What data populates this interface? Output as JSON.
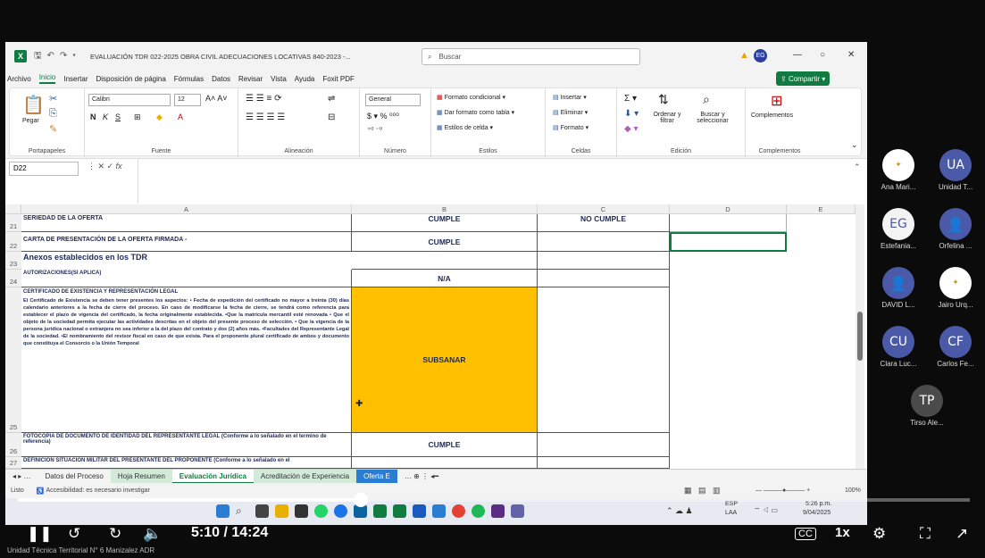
{
  "excel": {
    "title": "EVALUACIÓN TDR 022-2025 OBRA CIVIL ADECUACIONES LOCATIVAS 840-2023 -...",
    "search_placeholder": "Buscar",
    "user_initials": "EG",
    "window_controls": [
      "—",
      "○",
      "✕"
    ],
    "menu": [
      "Archivo",
      "Inicio",
      "Insertar",
      "Disposición de página",
      "Fórmulas",
      "Datos",
      "Revisar",
      "Vista",
      "Ayuda",
      "Foxit PDF"
    ],
    "share_label": "Compartir",
    "ribbon": {
      "paste_label": "Pegar",
      "font_name": "Calibri",
      "font_size": "12",
      "number_format": "General",
      "cond_format": "Formato condicional",
      "table_format": "Dar formato como tabla",
      "cell_styles": "Estilos de celda",
      "insert": "Insertar",
      "delete": "Eliminar",
      "format": "Formato",
      "sort_filter": "Ordenar y filtrar",
      "find_select": "Buscar y seleccionar",
      "addins": "Complementos",
      "groups": [
        "Portapapeles",
        "Fuente",
        "Alineación",
        "Número",
        "Estilos",
        "Celdas",
        "Edición",
        "Complementos"
      ]
    },
    "name_box": "D22",
    "fx": "fx",
    "columns": [
      "A",
      "B",
      "C",
      "D",
      "E"
    ],
    "rows": [
      {
        "num": "21",
        "a": "SERIEDAD DE LA OFERTA",
        "b": "CUMPLE",
        "c": "NO CUMPLE"
      },
      {
        "num": "22",
        "a": "CARTA DE PRESENTACIÓN DE LA OFERTA FIRMADA -",
        "b": "CUMPLE",
        "c": ""
      },
      {
        "num": "23",
        "a": "Anexos establecidos en los TDR",
        "b": "",
        "c": ""
      },
      {
        "num": "24",
        "a": "AUTORIZACIONES(SI APLICA)",
        "b": "N/A",
        "c": ""
      },
      {
        "num": "25",
        "a_title": "CERTIFICADO DE EXISTENCIA Y REPRESENTACIÓN LEGAL",
        "a_body": "El Certificado de Existencia se deben tener presentes los aspectos: • Fecha de expedición del certificado no mayor a treinta (30) días calendario anteriores a la fecha de cierre del proceso. En caso de modificarse la fecha de cierre, se tendrá como referencia para establecer el plazo de vigencia del certificado, la fecha originalmente establecida. •Que la matrícula mercantil esté renovada • Que el objeto de la sociedad permita ejecutar las actividades descritas en el objeto del presente proceso de selección. • Que la vigencia de la persona jurídica nacional o extranjera no sea inferior a la del plazo del contrato y dos (2) años más. •Facultades del Representante Legal de la sociedad. •El nombramiento del revisor fiscal en caso de que exista. Para el proponente plural certificado de ambos y documento que constituya el Consorcio o la Unión Temporal",
        "b": "SUBSANAR",
        "c": ""
      },
      {
        "num": "26",
        "a": "FOTOCOPIA DE DOCUMENTO DE IDENTIDAD DEL REPRESENTANTE LEGAL (Conforme a lo señalado en el termino de referencia)",
        "b": "CUMPLE",
        "c": ""
      },
      {
        "num": "27",
        "a": "DEFINICION SITUACION MILITAR DEL PRESENTANTE DEL PROPONENTE (Conforme a lo señalado en el",
        "b": "",
        "c": ""
      }
    ],
    "sheet_tabs": [
      "Datos del Proceso",
      "Hoja Resumen",
      "Evaluación Jurídica",
      "Acreditación de Experiencia",
      "Oferta E"
    ],
    "status_ready": "Listo",
    "status_access": "Accesibilidad: es necesario investigar",
    "zoom": "100%",
    "highlight_color": "#ffc000"
  },
  "taskbar": {
    "lang": "ESP",
    "lang2": "LAA",
    "time": "5:26 p.m.",
    "date": "9/04/2025"
  },
  "participants": [
    {
      "initials": "",
      "name": "Ana Mari...",
      "color": "#ffffff",
      "logo": true
    },
    {
      "initials": "UA",
      "name": "Unidad T...",
      "color": "#4b5aa8"
    },
    {
      "initials": "EG",
      "name": "Estefania...",
      "color": "#f3f3f3",
      "dark_text": true
    },
    {
      "initials": "",
      "name": "Orfelina ...",
      "color": "#4b5aa8",
      "person": true
    },
    {
      "initials": "",
      "name": "DAVID L...",
      "color": "#4b5aa8",
      "person": true
    },
    {
      "initials": "",
      "name": "Jairo Urq...",
      "color": "#ffffff",
      "logo": true
    },
    {
      "initials": "CU",
      "name": "Clara Luc...",
      "color": "#4b5aa8"
    },
    {
      "initials": "CF",
      "name": "Carlos Fe...",
      "color": "#4b5aa8"
    },
    {
      "initials": "TP",
      "name": "Tirso Ale...",
      "color": "#4b4b4b"
    }
  ],
  "player": {
    "time": "5:10 / 14:24",
    "progress": 0.36,
    "speed": "1x",
    "cc": "CC",
    "channel": "Unidad Técnica Territorial N° 6 Manizalez ADR"
  }
}
